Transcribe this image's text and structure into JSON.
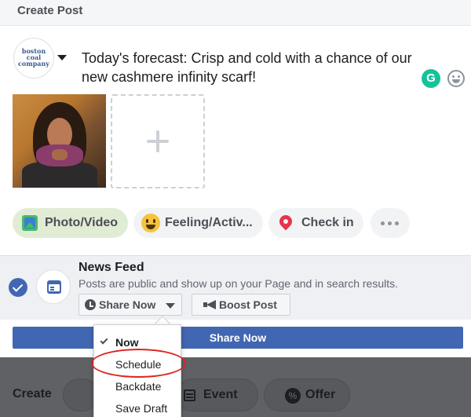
{
  "header": {
    "title": "Create Post"
  },
  "profile": {
    "avatar_text": "boston coal company"
  },
  "post": {
    "text": "Today's forecast: Crisp and cold with a chance of our new cashmere infinity scarf!"
  },
  "extensions": {
    "grammarly_letter": "G"
  },
  "actions": {
    "photo_video": "Photo/Video",
    "feeling": "Feeling/Activ...",
    "check_in": "Check in"
  },
  "news_feed": {
    "title": "News Feed",
    "description": "Posts are public and show up on your Page and in search results.",
    "share_now_dropdown": "Share Now",
    "boost_post": "Boost Post"
  },
  "share_button": "Share Now",
  "dropdown_menu": {
    "items": [
      "Now",
      "Schedule",
      "Backdate",
      "Save Draft"
    ],
    "selected": "Now",
    "highlighted": "Schedule"
  },
  "background_bar": {
    "create_label": "Create",
    "event_label": "Event",
    "offer_label": "Offer",
    "offer_icon_text": "%"
  },
  "colors": {
    "facebook_blue": "#4267b2",
    "grammarly_green": "#15c39a",
    "highlight_red": "#e02222"
  }
}
